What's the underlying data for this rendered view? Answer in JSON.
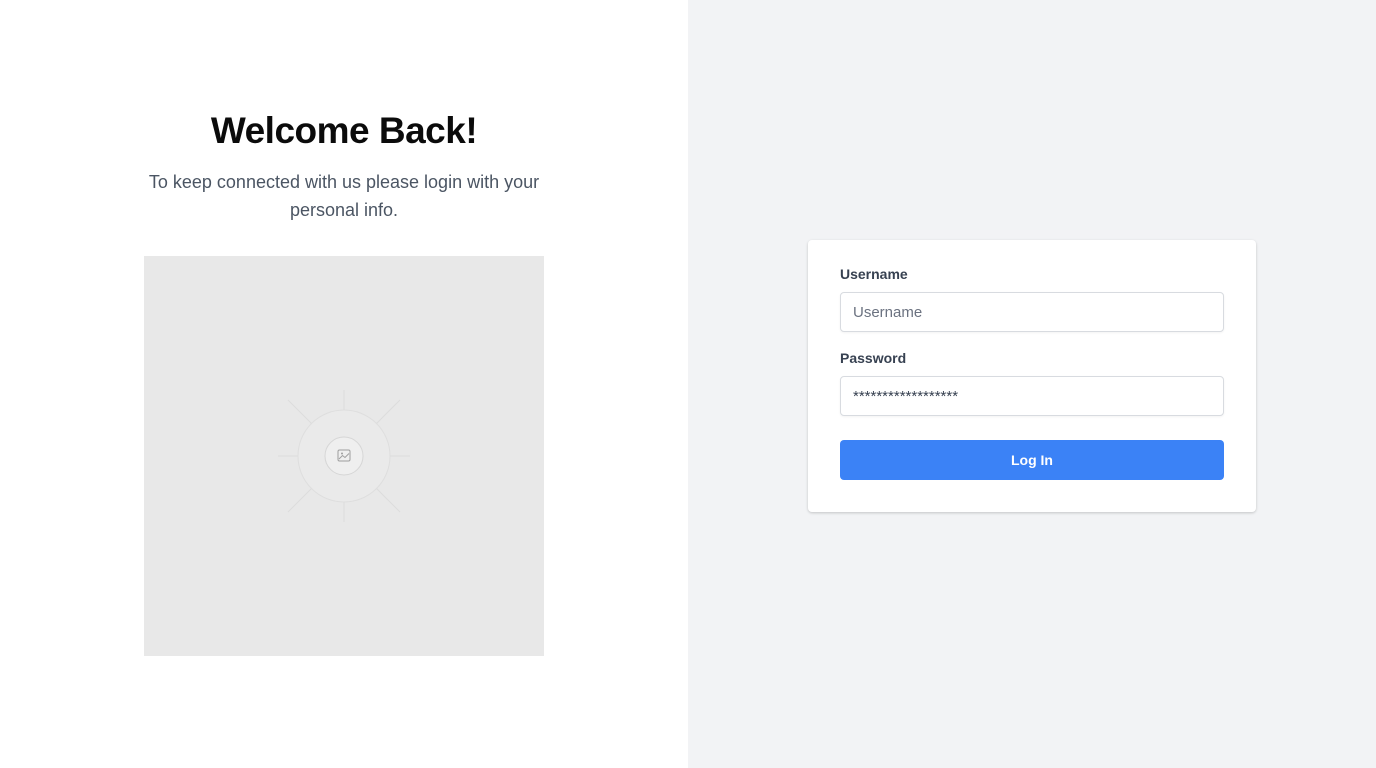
{
  "welcome": {
    "title": "Welcome Back!",
    "subtitle": "To keep connected with us please login with your personal info."
  },
  "image": {
    "icon": "image-icon"
  },
  "login_form": {
    "username_label": "Username",
    "username_placeholder": "Username",
    "username_value": "",
    "password_label": "Password",
    "password_value": "******************",
    "submit_label": "Log In"
  },
  "colors": {
    "accent": "#3b82f6",
    "right_background": "#f2f3f5",
    "image_background": "#e8e8e8"
  }
}
